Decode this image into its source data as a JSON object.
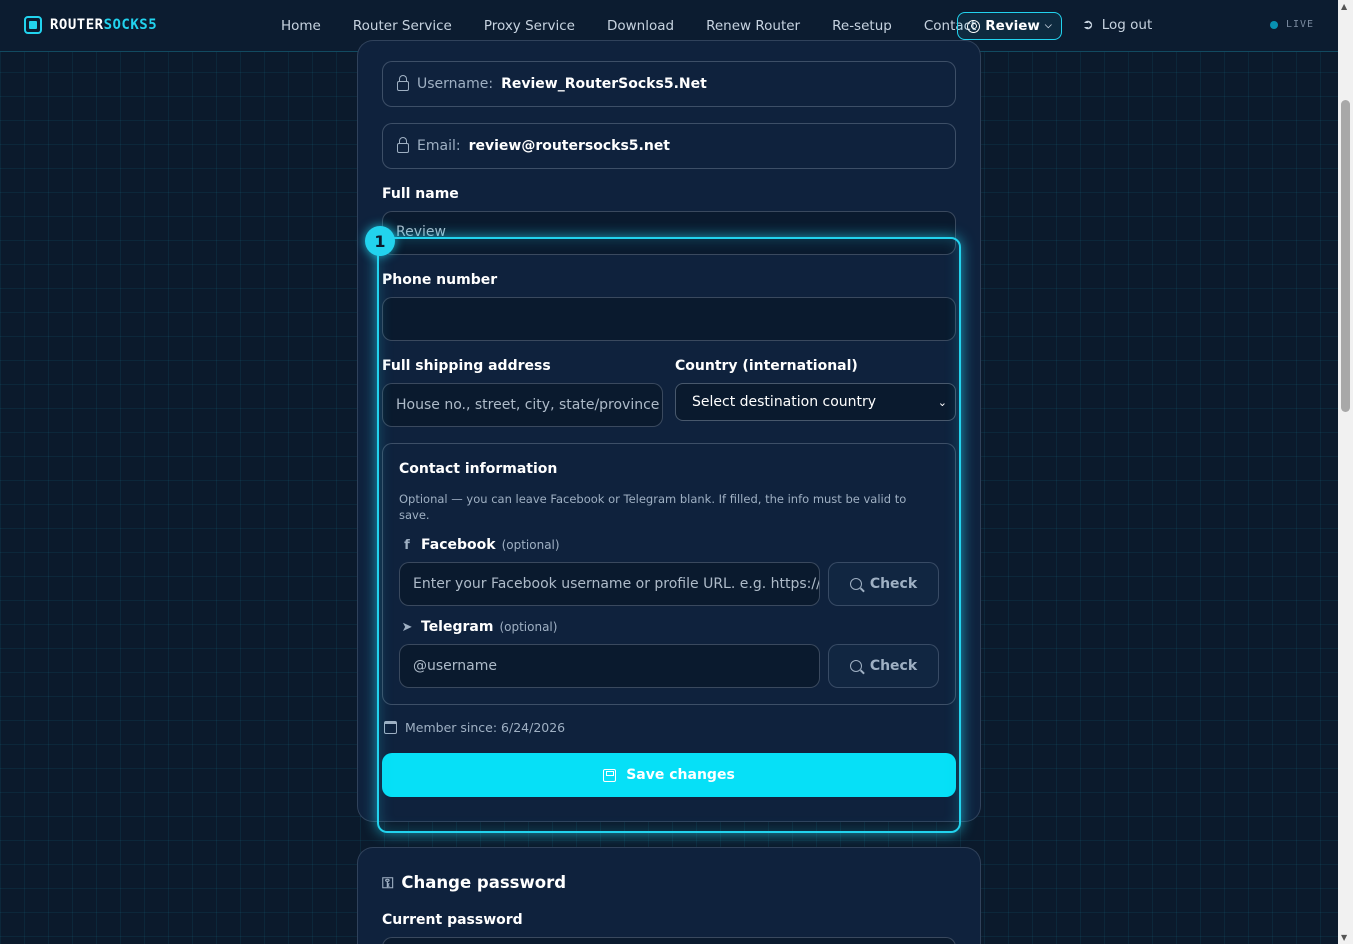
{
  "brand": {
    "part1": "ROUTER",
    "part2": "SOCKS5"
  },
  "nav": {
    "items": [
      "Home",
      "Router Service",
      "Proxy Service",
      "Download",
      "Renew Router",
      "Re-setup",
      "Contact"
    ],
    "account_label": "Review",
    "logout_label": "Log out",
    "status_label": "LIVE"
  },
  "profile": {
    "username_label": "Username:",
    "username_value": "Review_RouterSocks5.Net",
    "email_label": "Email:",
    "email_value": "review@routersocks5.net",
    "fullname_label": "Full name",
    "fullname_value": "Review",
    "phone_label": "Phone number",
    "phone_value": "",
    "address_label": "Full shipping address",
    "address_placeholder": "House no., street, city, state/province",
    "country_label": "Country (international)",
    "country_selected": "Select destination country"
  },
  "contact": {
    "title": "Contact information",
    "description": "Optional — you can leave Facebook or Telegram blank. If filled, the info must be valid to save.",
    "facebook_label": "Facebook",
    "facebook_optional": "(optional)",
    "facebook_placeholder": "Enter your Facebook username or profile URL. e.g. https://",
    "telegram_label": "Telegram",
    "telegram_optional": "(optional)",
    "telegram_placeholder": "@username",
    "check_label": "Check"
  },
  "member_since": "Member since: 6/24/2026",
  "save_label": "Save changes",
  "highlight_number": "1",
  "change_password": {
    "title": "Change password",
    "current_label": "Current password"
  },
  "colors": {
    "accent": "#22d3ee",
    "background": "#0b1a2c",
    "card": "#0f223d"
  }
}
